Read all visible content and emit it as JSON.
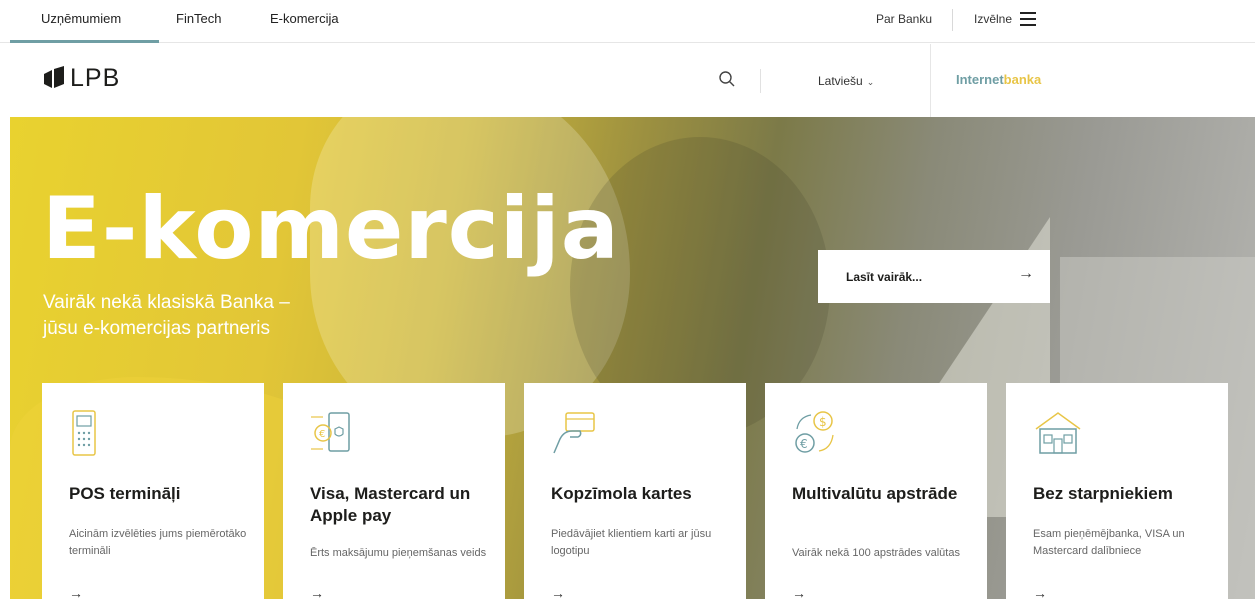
{
  "topnav": {
    "tabs": [
      "Uzņēmumiem",
      "FinTech",
      "E-komercija"
    ],
    "about": "Par Banku",
    "menu": "Izvēlne"
  },
  "header": {
    "logo_text": "LPB",
    "language": "Latviešu",
    "internetbank_part1": "Internet",
    "internetbank_part2": "banka"
  },
  "hero": {
    "title": "E-komercija",
    "subtitle_line1": "Vairāk nekā klasiskā Banka –",
    "subtitle_line2": "jūsu e-komercijas partneris",
    "cta_label": "Lasīt vairāk...",
    "cta_arrow": "→"
  },
  "cards": [
    {
      "title": "POS termināļi",
      "desc": "Aicinām izvēlēties jums piemērotāko termināli",
      "icon": "pos-terminal-icon"
    },
    {
      "title": "Visa, Mastercard un Apple pay",
      "desc": "Ērts maksājumu pieņemšanas veids",
      "icon": "payment-phone-icon"
    },
    {
      "title": "Kopzīmola kartes",
      "desc": "Piedāvājiet klientiem karti ar jūsu logotipu",
      "icon": "card-hand-icon"
    },
    {
      "title": "Multivalūtu apstrāde",
      "desc": "Vairāk nekā 100 apstrādes valūtas",
      "icon": "currency-exchange-icon"
    },
    {
      "title": "Bez starpniekiem",
      "desc": "Esam pieņēmējbanka, VISA un Mastercard dalībniece",
      "icon": "house-icon"
    }
  ],
  "colors": {
    "accent_teal": "#6f9ea4",
    "accent_yellow": "#e8c547",
    "hero_yellow": "#e9d22f"
  }
}
